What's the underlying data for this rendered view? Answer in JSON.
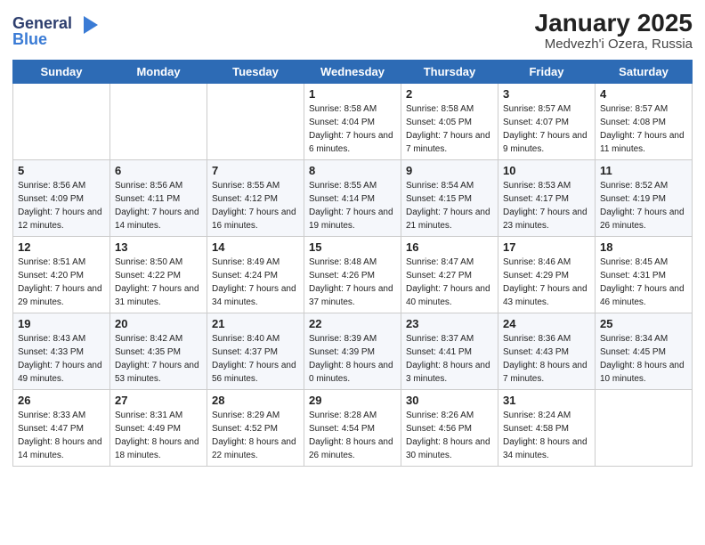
{
  "logo": {
    "general": "General",
    "blue": "Blue"
  },
  "title": "January 2025",
  "subtitle": "Medvezh'i Ozera, Russia",
  "days_of_week": [
    "Sunday",
    "Monday",
    "Tuesday",
    "Wednesday",
    "Thursday",
    "Friday",
    "Saturday"
  ],
  "weeks": [
    [
      {
        "day": "",
        "sunrise": "",
        "sunset": "",
        "daylight": ""
      },
      {
        "day": "",
        "sunrise": "",
        "sunset": "",
        "daylight": ""
      },
      {
        "day": "",
        "sunrise": "",
        "sunset": "",
        "daylight": ""
      },
      {
        "day": "1",
        "sunrise": "Sunrise: 8:58 AM",
        "sunset": "Sunset: 4:04 PM",
        "daylight": "Daylight: 7 hours and 6 minutes."
      },
      {
        "day": "2",
        "sunrise": "Sunrise: 8:58 AM",
        "sunset": "Sunset: 4:05 PM",
        "daylight": "Daylight: 7 hours and 7 minutes."
      },
      {
        "day": "3",
        "sunrise": "Sunrise: 8:57 AM",
        "sunset": "Sunset: 4:07 PM",
        "daylight": "Daylight: 7 hours and 9 minutes."
      },
      {
        "day": "4",
        "sunrise": "Sunrise: 8:57 AM",
        "sunset": "Sunset: 4:08 PM",
        "daylight": "Daylight: 7 hours and 11 minutes."
      }
    ],
    [
      {
        "day": "5",
        "sunrise": "Sunrise: 8:56 AM",
        "sunset": "Sunset: 4:09 PM",
        "daylight": "Daylight: 7 hours and 12 minutes."
      },
      {
        "day": "6",
        "sunrise": "Sunrise: 8:56 AM",
        "sunset": "Sunset: 4:11 PM",
        "daylight": "Daylight: 7 hours and 14 minutes."
      },
      {
        "day": "7",
        "sunrise": "Sunrise: 8:55 AM",
        "sunset": "Sunset: 4:12 PM",
        "daylight": "Daylight: 7 hours and 16 minutes."
      },
      {
        "day": "8",
        "sunrise": "Sunrise: 8:55 AM",
        "sunset": "Sunset: 4:14 PM",
        "daylight": "Daylight: 7 hours and 19 minutes."
      },
      {
        "day": "9",
        "sunrise": "Sunrise: 8:54 AM",
        "sunset": "Sunset: 4:15 PM",
        "daylight": "Daylight: 7 hours and 21 minutes."
      },
      {
        "day": "10",
        "sunrise": "Sunrise: 8:53 AM",
        "sunset": "Sunset: 4:17 PM",
        "daylight": "Daylight: 7 hours and 23 minutes."
      },
      {
        "day": "11",
        "sunrise": "Sunrise: 8:52 AM",
        "sunset": "Sunset: 4:19 PM",
        "daylight": "Daylight: 7 hours and 26 minutes."
      }
    ],
    [
      {
        "day": "12",
        "sunrise": "Sunrise: 8:51 AM",
        "sunset": "Sunset: 4:20 PM",
        "daylight": "Daylight: 7 hours and 29 minutes."
      },
      {
        "day": "13",
        "sunrise": "Sunrise: 8:50 AM",
        "sunset": "Sunset: 4:22 PM",
        "daylight": "Daylight: 7 hours and 31 minutes."
      },
      {
        "day": "14",
        "sunrise": "Sunrise: 8:49 AM",
        "sunset": "Sunset: 4:24 PM",
        "daylight": "Daylight: 7 hours and 34 minutes."
      },
      {
        "day": "15",
        "sunrise": "Sunrise: 8:48 AM",
        "sunset": "Sunset: 4:26 PM",
        "daylight": "Daylight: 7 hours and 37 minutes."
      },
      {
        "day": "16",
        "sunrise": "Sunrise: 8:47 AM",
        "sunset": "Sunset: 4:27 PM",
        "daylight": "Daylight: 7 hours and 40 minutes."
      },
      {
        "day": "17",
        "sunrise": "Sunrise: 8:46 AM",
        "sunset": "Sunset: 4:29 PM",
        "daylight": "Daylight: 7 hours and 43 minutes."
      },
      {
        "day": "18",
        "sunrise": "Sunrise: 8:45 AM",
        "sunset": "Sunset: 4:31 PM",
        "daylight": "Daylight: 7 hours and 46 minutes."
      }
    ],
    [
      {
        "day": "19",
        "sunrise": "Sunrise: 8:43 AM",
        "sunset": "Sunset: 4:33 PM",
        "daylight": "Daylight: 7 hours and 49 minutes."
      },
      {
        "day": "20",
        "sunrise": "Sunrise: 8:42 AM",
        "sunset": "Sunset: 4:35 PM",
        "daylight": "Daylight: 7 hours and 53 minutes."
      },
      {
        "day": "21",
        "sunrise": "Sunrise: 8:40 AM",
        "sunset": "Sunset: 4:37 PM",
        "daylight": "Daylight: 7 hours and 56 minutes."
      },
      {
        "day": "22",
        "sunrise": "Sunrise: 8:39 AM",
        "sunset": "Sunset: 4:39 PM",
        "daylight": "Daylight: 8 hours and 0 minutes."
      },
      {
        "day": "23",
        "sunrise": "Sunrise: 8:37 AM",
        "sunset": "Sunset: 4:41 PM",
        "daylight": "Daylight: 8 hours and 3 minutes."
      },
      {
        "day": "24",
        "sunrise": "Sunrise: 8:36 AM",
        "sunset": "Sunset: 4:43 PM",
        "daylight": "Daylight: 8 hours and 7 minutes."
      },
      {
        "day": "25",
        "sunrise": "Sunrise: 8:34 AM",
        "sunset": "Sunset: 4:45 PM",
        "daylight": "Daylight: 8 hours and 10 minutes."
      }
    ],
    [
      {
        "day": "26",
        "sunrise": "Sunrise: 8:33 AM",
        "sunset": "Sunset: 4:47 PM",
        "daylight": "Daylight: 8 hours and 14 minutes."
      },
      {
        "day": "27",
        "sunrise": "Sunrise: 8:31 AM",
        "sunset": "Sunset: 4:49 PM",
        "daylight": "Daylight: 8 hours and 18 minutes."
      },
      {
        "day": "28",
        "sunrise": "Sunrise: 8:29 AM",
        "sunset": "Sunset: 4:52 PM",
        "daylight": "Daylight: 8 hours and 22 minutes."
      },
      {
        "day": "29",
        "sunrise": "Sunrise: 8:28 AM",
        "sunset": "Sunset: 4:54 PM",
        "daylight": "Daylight: 8 hours and 26 minutes."
      },
      {
        "day": "30",
        "sunrise": "Sunrise: 8:26 AM",
        "sunset": "Sunset: 4:56 PM",
        "daylight": "Daylight: 8 hours and 30 minutes."
      },
      {
        "day": "31",
        "sunrise": "Sunrise: 8:24 AM",
        "sunset": "Sunset: 4:58 PM",
        "daylight": "Daylight: 8 hours and 34 minutes."
      },
      {
        "day": "",
        "sunrise": "",
        "sunset": "",
        "daylight": ""
      }
    ]
  ]
}
